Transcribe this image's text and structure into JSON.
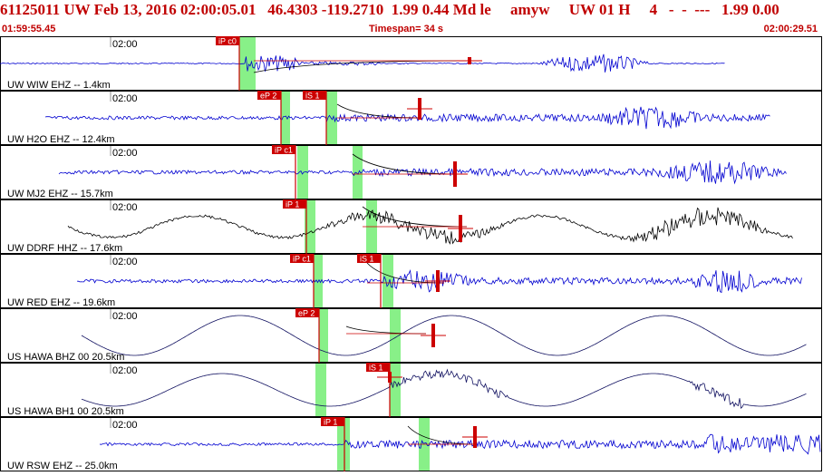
{
  "header": {
    "title": "61125011 UW Feb 13, 2016 02:00:05.01   46.4303 -119.2710  1.99 0.44 Md le     amyw     UW 01 H     4   -  -  ---   1.99 0.00",
    "start_time": "01:59:55.45",
    "timespan": "Timespan=  34 s",
    "end_time": "02:00:29.51"
  },
  "colors": {
    "accent_red": "#cc0000",
    "pick_green": "#88f088",
    "trace_blue": "#0000d0",
    "trace_black": "#000000",
    "trace_navy": "#101060",
    "tick_gray": "#909090"
  },
  "traces": [
    {
      "label": "UW WIW EHZ -- 1.4km",
      "tick_label": "02:00",
      "picks": [
        "iP c0"
      ],
      "color": "trace_blue"
    },
    {
      "label": "UW H2O EHZ -- 12.4km",
      "tick_label": "02:00",
      "picks": [
        "eP 2",
        "iS 1"
      ],
      "color": "trace_blue"
    },
    {
      "label": "UW MJ2 EHZ -- 15.7km",
      "tick_label": "02:00",
      "picks": [
        "iP c1"
      ],
      "color": "trace_blue"
    },
    {
      "label": "UW DDRF HHZ -- 17.6km",
      "tick_label": "02:00",
      "picks": [
        "iP 1"
      ],
      "color": "trace_black"
    },
    {
      "label": "UW RED EHZ -- 19.6km",
      "tick_label": "02:00",
      "picks": [
        "iP c1",
        "iS 1"
      ],
      "color": "trace_blue"
    },
    {
      "label": "US HAWA BHZ 00 20.5km",
      "tick_label": "02:00",
      "picks": [
        "eP 2"
      ],
      "color": "trace_navy"
    },
    {
      "label": "US HAWA BH1 00 20.5km",
      "tick_label": "02:00",
      "picks": [
        "iS 1"
      ],
      "color": "trace_navy"
    },
    {
      "label": "UW RSW EHZ -- 25.0km",
      "tick_label": "02:00",
      "picks": [
        "iP 1"
      ],
      "color": "trace_blue"
    }
  ]
}
